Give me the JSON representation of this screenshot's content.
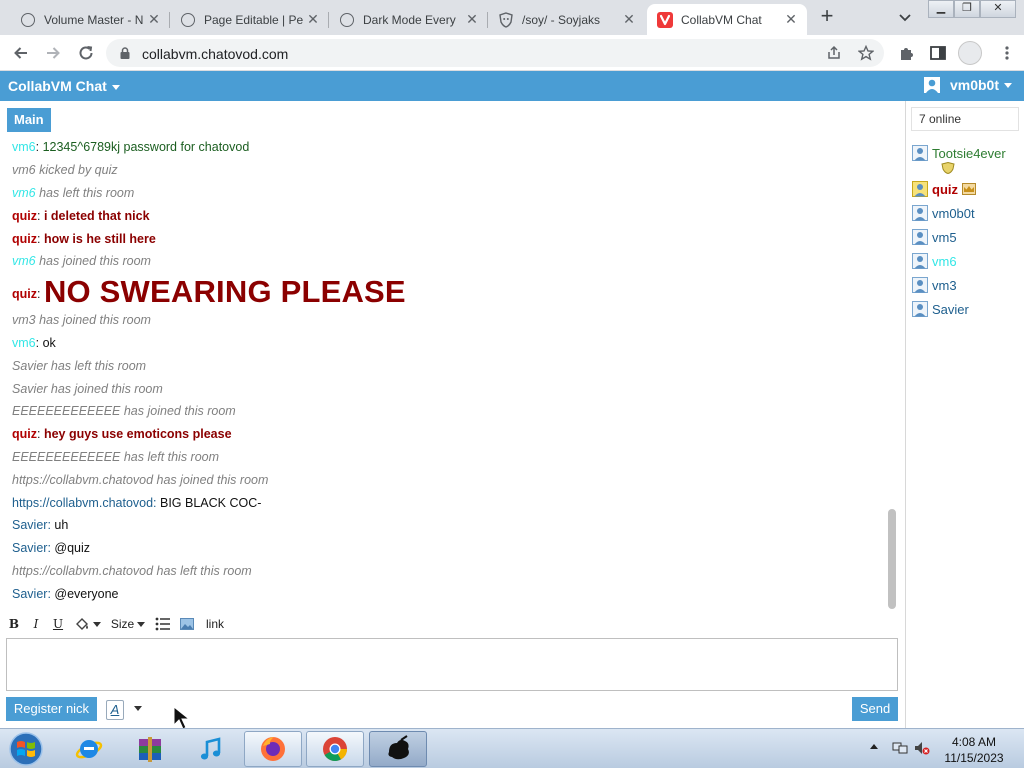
{
  "browser": {
    "tabs": [
      {
        "label": "Volume Master - N",
        "icon": "globe-icon",
        "active": false
      },
      {
        "label": "Page Editable | Pe",
        "icon": "globe-icon",
        "active": false
      },
      {
        "label": "Dark Mode Every",
        "icon": "globe-icon",
        "active": false
      },
      {
        "label": "/soy/ - Soyjaks",
        "icon": "shield-icon",
        "active": false
      },
      {
        "label": "CollabVM Chat",
        "icon": "vivaldi-icon",
        "active": true
      }
    ],
    "url": "collabvm.chatovod.com"
  },
  "chat": {
    "title": "CollabVM Chat",
    "current_user": "vm0b0t",
    "room_tab": "Main",
    "messages": [
      {
        "type": "user",
        "name": "vm6",
        "sep": ": ",
        "text": "12345^6789kj password for chatovod"
      },
      {
        "type": "sys",
        "text": "vm6 kicked by quiz"
      },
      {
        "type": "sys-name",
        "name": "vm6",
        "text": " has left this room"
      },
      {
        "type": "user",
        "name": "quiz",
        "sep": ": ",
        "text": "i deleted that nick"
      },
      {
        "type": "user",
        "name": "quiz",
        "sep": ": ",
        "text": "how is he still here"
      },
      {
        "type": "sys-name",
        "name": "vm6",
        "text": " has joined this room"
      },
      {
        "type": "user",
        "name": "quiz",
        "sep": ": ",
        "text": "NO SWEARING PLEASE"
      },
      {
        "type": "sys",
        "text": "vm3 has joined this room"
      },
      {
        "type": "user",
        "name": "vm6",
        "sep": ": ",
        "text": "ok"
      },
      {
        "type": "sys",
        "text": "Savier has left this room"
      },
      {
        "type": "sys",
        "text": "Savier has joined this room"
      },
      {
        "type": "sys",
        "text": "EEEEEEEEEEEEE has joined this room"
      },
      {
        "type": "user",
        "name": "quiz",
        "sep": ": ",
        "text": "hey guys use emoticons please"
      },
      {
        "type": "sys",
        "text": "EEEEEEEEEEEEE has left this room"
      },
      {
        "type": "sys",
        "text": "https://collabvm.chatovod has joined this room"
      },
      {
        "type": "user",
        "name": "https://collabvm.chatovod",
        "sep": ": ",
        "text": "BIG BLACK COC-"
      },
      {
        "type": "user",
        "name": "Savier",
        "sep": ": ",
        "text": "uh"
      },
      {
        "type": "user",
        "name": "Savier",
        "sep": ": ",
        "text": "@quiz"
      },
      {
        "type": "sys",
        "text": "https://collabvm.chatovod has left this room"
      },
      {
        "type": "user",
        "name": "Savier",
        "sep": ": ",
        "text": "@everyone"
      }
    ],
    "toolbar": {
      "bold": "B",
      "italic": "I",
      "underline": "U",
      "size": "Size",
      "link": "link"
    },
    "input_value": "",
    "register_label": "Register nick",
    "format_label": "A",
    "send_label": "Send"
  },
  "users": {
    "online_label": "7 online",
    "list": [
      {
        "name": "Tootsie4ever",
        "badge": "shield-badge-icon"
      },
      {
        "name": "quiz",
        "badge": "crown-icon"
      },
      {
        "name": "vm0b0t",
        "badge": ""
      },
      {
        "name": "vm5",
        "badge": ""
      },
      {
        "name": "vm6",
        "badge": ""
      },
      {
        "name": "vm3",
        "badge": ""
      },
      {
        "name": "Savier",
        "badge": ""
      }
    ]
  },
  "taskbar": {
    "apps": [
      "internet-explorer-icon",
      "winrar-icon",
      "itunes-icon",
      "firefox-icon",
      "chrome-icon",
      "ink-blot-icon"
    ],
    "time": "4:08 AM",
    "date": "11/15/2023"
  },
  "colors": {
    "header_blue": "#4a9dd4",
    "name_cyan": "#33e6e6",
    "quiz_red": "#b00000",
    "tootsie_green": "#2e7d32"
  }
}
